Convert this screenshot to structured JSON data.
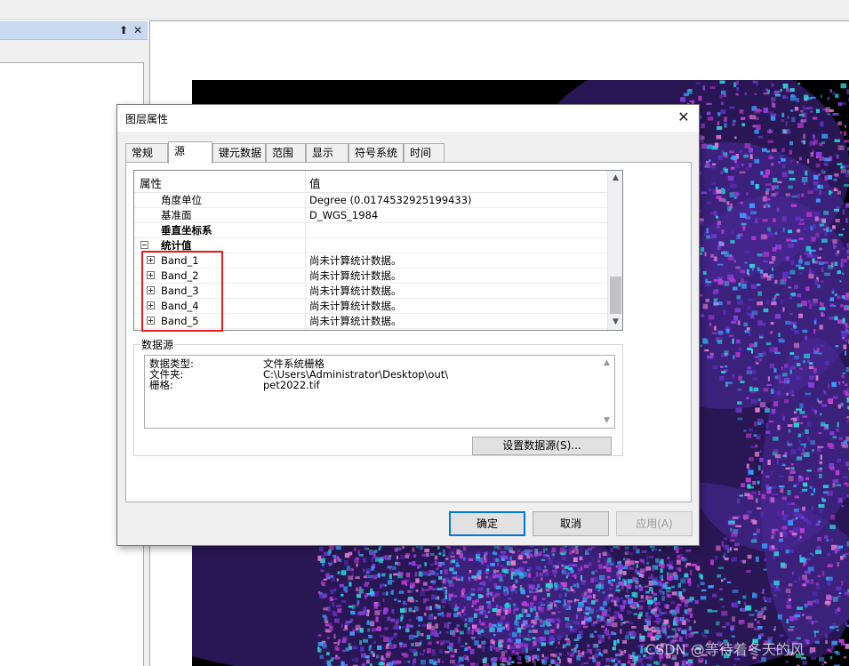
{
  "dock": {
    "pin_icon": "pin-icon",
    "pin_glyph": "⬆",
    "close_glyph": "✕"
  },
  "map": {
    "accent_colors": [
      "#5b2fc4",
      "#c13ad6",
      "#2bd4d8",
      "#8a3fe0",
      "#e07ad0",
      "#3aa0ff"
    ]
  },
  "watermark": "CSDN @等待着冬天的风",
  "dialog": {
    "title": "图层属性",
    "close_glyph": "✕",
    "tabs": [
      "常规",
      "源",
      "键元数据",
      "范围",
      "显示",
      "符号系统",
      "时间"
    ],
    "active_tab": "源",
    "properties": {
      "header_key": "属性",
      "header_value": "值",
      "rows": [
        {
          "key": "角度单位",
          "value": "Degree (0.0174532925199433)"
        },
        {
          "key": "基准面",
          "value": "D_WGS_1984"
        },
        {
          "key": "垂直坐标系",
          "value": ""
        },
        {
          "key": "统计值",
          "value": ""
        },
        {
          "key": "Band_1",
          "value": "尚未计算统计数据。"
        },
        {
          "key": "Band_2",
          "value": "尚未计算统计数据。"
        },
        {
          "key": "Band_3",
          "value": "尚未计算统计数据。"
        },
        {
          "key": "Band_4",
          "value": "尚未计算统计数据。"
        },
        {
          "key": "Band_5",
          "value": "尚未计算统计数据。"
        }
      ],
      "scroll_up": "▲",
      "scroll_down": "▼"
    },
    "datasource": {
      "label": "数据源",
      "rows": [
        {
          "key": "数据类型:",
          "value": "文件系统栅格"
        },
        {
          "key": "文件夹:",
          "value": "C:\\Users\\Administrator\\Desktop\\out\\"
        },
        {
          "key": "栅格:",
          "value": "pet2022.tif"
        }
      ],
      "scroll_up": "▲",
      "scroll_down": "▼",
      "set_source_label": "设置数据源(S)..."
    },
    "buttons": {
      "ok": "确定",
      "cancel": "取消",
      "apply": "应用(A)"
    },
    "highlight_color": "#e11d1d"
  }
}
